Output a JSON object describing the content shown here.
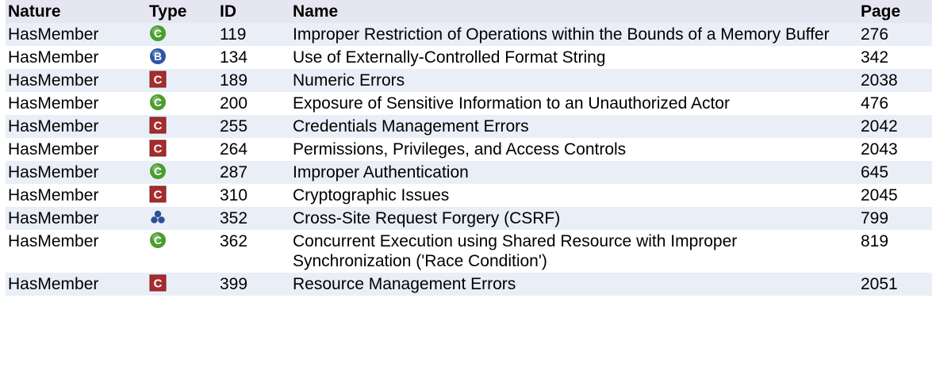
{
  "headers": {
    "nature": "Nature",
    "type": "Type",
    "id": "ID",
    "name": "Name",
    "page": "Page"
  },
  "icon_colors": {
    "class": "#4a9e2c",
    "base": "#2f55a8",
    "category": "#a52d2d",
    "composite": "#2f4f9a"
  },
  "rows": [
    {
      "nature": "HasMember",
      "type_icon": "class-icon",
      "id": "119",
      "name": "Improper Restriction of Operations within the Bounds of a Memory Buffer",
      "page": "276"
    },
    {
      "nature": "HasMember",
      "type_icon": "base-icon",
      "id": "134",
      "name": "Use of Externally-Controlled Format String",
      "page": "342"
    },
    {
      "nature": "HasMember",
      "type_icon": "category-icon",
      "id": "189",
      "name": "Numeric Errors",
      "page": "2038"
    },
    {
      "nature": "HasMember",
      "type_icon": "class-icon",
      "id": "200",
      "name": "Exposure of Sensitive Information to an Unauthorized Actor",
      "page": "476"
    },
    {
      "nature": "HasMember",
      "type_icon": "category-icon",
      "id": "255",
      "name": "Credentials Management Errors",
      "page": "2042"
    },
    {
      "nature": "HasMember",
      "type_icon": "category-icon",
      "id": "264",
      "name": "Permissions, Privileges, and Access Controls",
      "page": "2043"
    },
    {
      "nature": "HasMember",
      "type_icon": "class-icon",
      "id": "287",
      "name": "Improper Authentication",
      "page": "645"
    },
    {
      "nature": "HasMember",
      "type_icon": "category-icon",
      "id": "310",
      "name": "Cryptographic Issues",
      "page": "2045"
    },
    {
      "nature": "HasMember",
      "type_icon": "composite-icon",
      "id": "352",
      "name": "Cross-Site Request Forgery (CSRF)",
      "page": "799"
    },
    {
      "nature": "HasMember",
      "type_icon": "class-icon",
      "id": "362",
      "name": "Concurrent Execution using Shared Resource with Improper Synchronization ('Race Condition')",
      "page": "819"
    },
    {
      "nature": "HasMember",
      "type_icon": "category-icon",
      "id": "399",
      "name": "Resource Management Errors",
      "page": "2051"
    }
  ]
}
